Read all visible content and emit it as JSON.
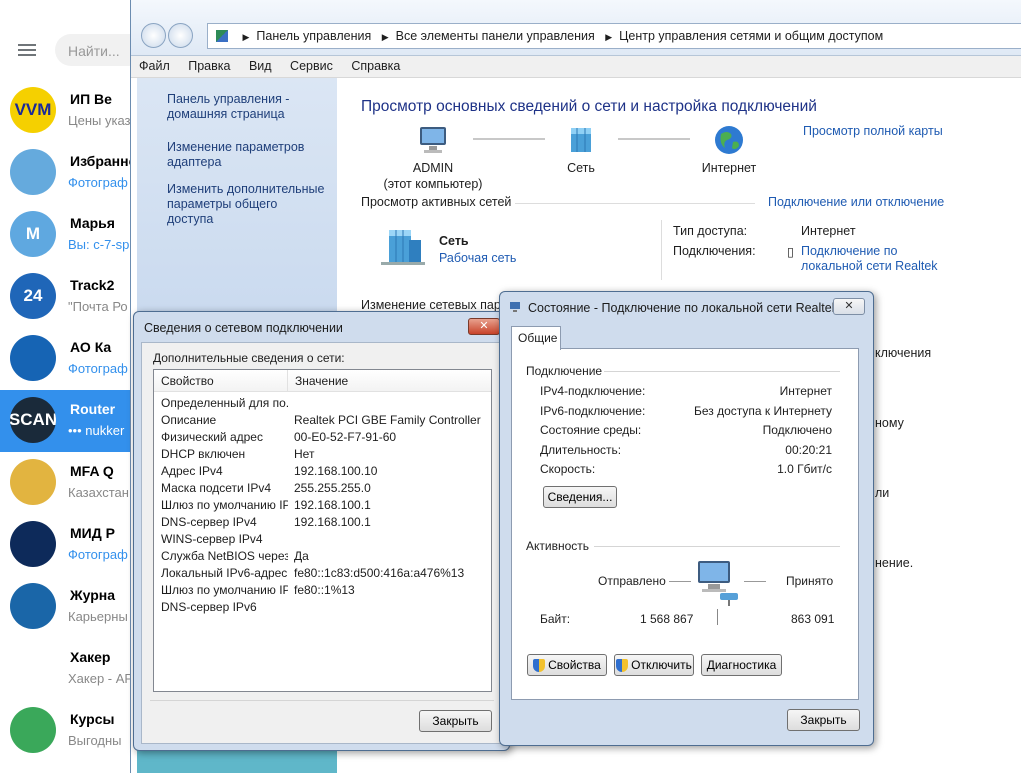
{
  "telegram": {
    "search_placeholder": "Найти...",
    "chats": [
      {
        "name": "ИП Ве",
        "preview": "Цены указ",
        "avatar": "VVM",
        "color": "#f5d000",
        "blue": false
      },
      {
        "name": "Избранно",
        "preview": "Фотограф",
        "avatar": "",
        "color": "#65aadd",
        "blue": true
      },
      {
        "name": "Марья",
        "preview": "Вы: с-7-sp",
        "avatar": "М",
        "color": "#5fa8e0",
        "blue": true
      },
      {
        "name": "Track2",
        "preview": "\"Почта Ро",
        "avatar": "24",
        "color": "#1f66b8",
        "blue": false
      },
      {
        "name": "АО Ка",
        "preview": "Фотограф",
        "avatar": "",
        "color": "#1664b4",
        "blue": true
      },
      {
        "name": "Router",
        "preview": "••• nukker",
        "avatar": "SCAN",
        "color": "#1a2a3a",
        "blue": false
      },
      {
        "name": "MFA Q",
        "preview": "Казахстан",
        "avatar": "",
        "color": "#e2b440",
        "blue": false
      },
      {
        "name": "МИД Р",
        "preview": "Фотограф",
        "avatar": "",
        "color": "#0d2a5a",
        "blue": true
      },
      {
        "name": "Журна",
        "preview": "Карьерны",
        "avatar": "",
        "color": "#1a66a8",
        "blue": false
      },
      {
        "name": "Хакер",
        "preview": "Хакер - АР",
        "avatar": "",
        "color": "#ffffff",
        "blue": false
      },
      {
        "name": "Курсы",
        "preview": "Выгодны",
        "avatar": "",
        "color": "#3aa85a",
        "blue": false
      }
    ]
  },
  "explorer": {
    "breadcrumbs": [
      "Панель управления",
      "Все элементы панели управления",
      "Центр управления сетями и общим доступом"
    ],
    "menu": [
      "Файл",
      "Правка",
      "Вид",
      "Сервис",
      "Справка"
    ],
    "sidebar": [
      "Панель управления - домашняя страница",
      "Изменение параметров адаптера",
      "Изменить дополнительные параметры общего доступа"
    ],
    "title": "Просмотр основных сведений о сети и настройка подключений",
    "full_map_link": "Просмотр полной карты",
    "map": {
      "computer": "ADMIN",
      "computer_sub": "(этот компьютер)",
      "network": "Сеть",
      "internet": "Интернет"
    },
    "active_title": "Просмотр активных сетей",
    "connect_link": "Подключение или отключение",
    "active_net": {
      "name": "Сеть",
      "type": "Рабочая сеть"
    },
    "access_type_label": "Тип доступа:",
    "access_type_value": "Интернет",
    "connections_label": "Подключения:",
    "connections_value": "Подключение по локальной сети Realtek",
    "change_title": "Изменение сетевых парам",
    "bg_fragments": [
      "ключения",
      "ному",
      "ли",
      "нение."
    ]
  },
  "details_dialog": {
    "title": "Сведения о сетевом подключении",
    "subtitle": "Дополнительные сведения о сети:",
    "col_property": "Свойство",
    "col_value": "Значение",
    "rows": [
      {
        "k": "Определенный для по...",
        "v": ""
      },
      {
        "k": "Описание",
        "v": "Realtek PCI GBE Family Controller"
      },
      {
        "k": "Физический адрес",
        "v": "00-E0-52-F7-91-60"
      },
      {
        "k": "DHCP включен",
        "v": "Нет"
      },
      {
        "k": "Адрес IPv4",
        "v": "192.168.100.10"
      },
      {
        "k": "Маска подсети IPv4",
        "v": "255.255.255.0"
      },
      {
        "k": "Шлюз по умолчанию IP...",
        "v": "192.168.100.1"
      },
      {
        "k": "DNS-сервер IPv4",
        "v": "192.168.100.1"
      },
      {
        "k": "WINS-сервер IPv4",
        "v": ""
      },
      {
        "k": "Служба NetBIOS через...",
        "v": "Да"
      },
      {
        "k": "Локальный IPv6-адрес...",
        "v": "fe80::1c83:d500:416a:a476%13"
      },
      {
        "k": "Шлюз по умолчанию IP...",
        "v": "fe80::1%13"
      },
      {
        "k": "DNS-сервер IPv6",
        "v": ""
      }
    ],
    "close_label": "Закрыть"
  },
  "status_dialog": {
    "title": "Состояние - Подключение по локальной сети Realtek",
    "tab_general": "Общие",
    "connection_group": "Подключение",
    "rows": [
      {
        "k": "IPv4-подключение:",
        "v": "Интернет"
      },
      {
        "k": "IPv6-подключение:",
        "v": "Без доступа к Интернету"
      },
      {
        "k": "Состояние среды:",
        "v": "Подключено"
      },
      {
        "k": "Длительность:",
        "v": "00:20:21"
      },
      {
        "k": "Скорость:",
        "v": "1.0 Гбит/с"
      }
    ],
    "details_button": "Сведения...",
    "activity_group": "Активность",
    "sent_label": "Отправлено",
    "received_label": "Принято",
    "bytes_label": "Байт:",
    "bytes_sent": "1 568 867",
    "bytes_received": "863 091",
    "properties_button": "Свойства",
    "disable_button": "Отключить",
    "diagnose_button": "Диагностика",
    "close_label": "Закрыть"
  }
}
